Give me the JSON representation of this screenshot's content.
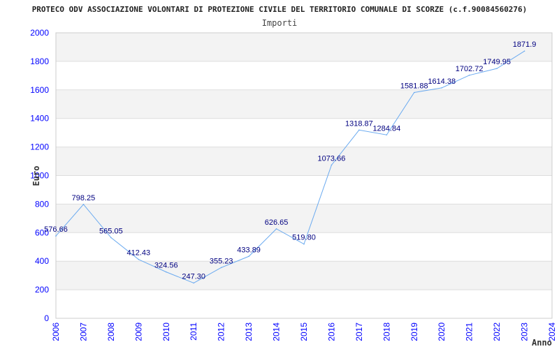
{
  "chart_data": {
    "type": "line",
    "title": "PROTECO ODV ASSOCIAZIONE VOLONTARI DI PROTEZIONE CIVILE DEL TERRITORIO COMUNALE DI SCORZE (c.f.90084560276)",
    "subtitle": "Importi",
    "xlabel": "Anno",
    "ylabel": "Euro",
    "ylim": [
      0,
      2000
    ],
    "yticks": [
      0,
      200,
      400,
      600,
      800,
      1000,
      1200,
      1400,
      1600,
      1800,
      2000
    ],
    "grid": true,
    "x": [
      "2006",
      "2007",
      "2008",
      "2009",
      "2010",
      "2011",
      "2012",
      "2013",
      "2014",
      "2015",
      "2016",
      "2017",
      "2018",
      "2019",
      "2020",
      "2021",
      "2022",
      "2023",
      "2024"
    ],
    "values": [
      576.66,
      798.25,
      565.05,
      412.43,
      324.56,
      247.3,
      355.23,
      433.89,
      626.65,
      519.8,
      1073.66,
      1318.87,
      1284.84,
      1581.88,
      1614.38,
      1702.72,
      1749.95,
      1871.9
    ],
    "labels": [
      "576.66",
      "798.25",
      "565.05",
      "412.43",
      "324.56",
      "247.30",
      "355.23",
      "433.89",
      "626.65",
      "519.80",
      "1073.66",
      "1318.87",
      "1284.84",
      "1581.88",
      "1614.38",
      "1702.72",
      "1749.95",
      "1871.9"
    ],
    "colors": {
      "line": "#6aaaf0",
      "label": "#000080",
      "tick": "#0000ff",
      "band": "#f3f3f3"
    }
  }
}
